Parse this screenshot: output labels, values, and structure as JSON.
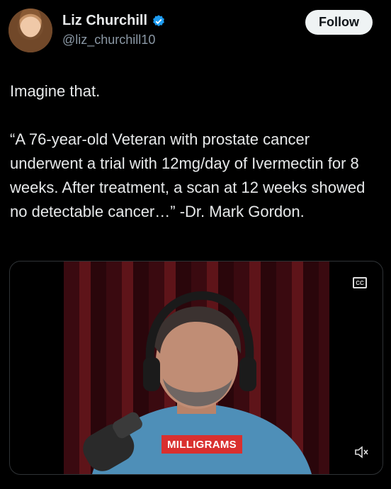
{
  "author": {
    "name": "Liz Churchill",
    "handle": "@liz_churchill10",
    "verified_icon": "verified-badge-icon",
    "avatar": "avatar"
  },
  "follow_label": "Follow",
  "tweet": {
    "text": "Imagine that.\n\n“A 76-year-old Veteran with prostate cancer underwent a trial with 12mg/day of Ivermectin for 8 weeks. After treatment, a scan at 12 weeks showed no detectable cancer…” -Dr. Mark Gordon."
  },
  "video": {
    "caption": "MILLIGRAMS",
    "cc_label": "CC",
    "icons": [
      "closed-captions-icon",
      "mute-icon"
    ]
  },
  "colors": {
    "background": "#000000",
    "text": "#e7e9ea",
    "secondary": "#8b98a5",
    "verified": "#1d9bf0",
    "caption_bg": "#d9302f"
  }
}
